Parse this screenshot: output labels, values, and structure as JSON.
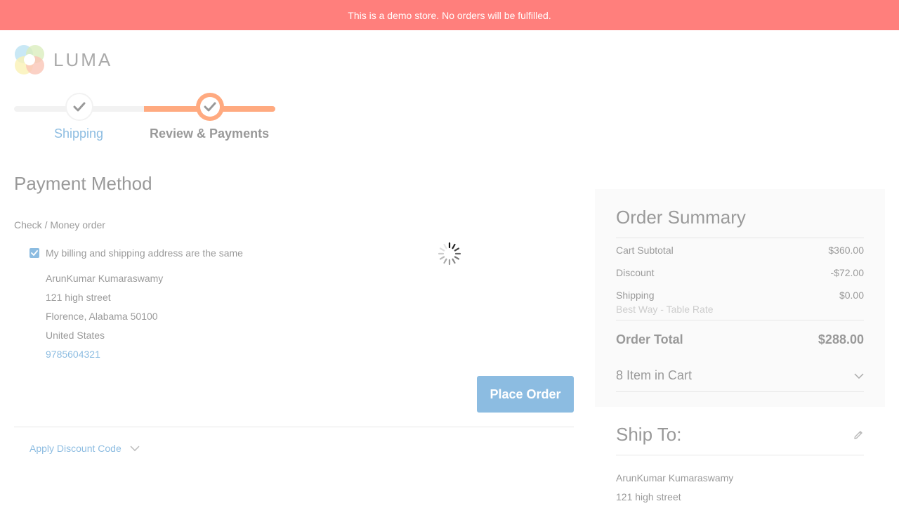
{
  "banner": {
    "text": "This is a demo store. No orders will be fulfilled."
  },
  "logo": {
    "text": "LUMA"
  },
  "progress": {
    "steps": [
      {
        "label": "Shipping"
      },
      {
        "label": "Review & Payments"
      }
    ]
  },
  "payment": {
    "title": "Payment Method",
    "method_title": "Check / Money order",
    "same_address_label": "My billing and shipping address are the same",
    "address": {
      "name": "ArunKumar Kumaraswamy",
      "street": "121 high street",
      "city_line": "Florence, Alabama 50100",
      "country": "United States",
      "phone": "9785604321"
    },
    "place_order_label": "Place Order",
    "discount_label": "Apply Discount Code"
  },
  "summary": {
    "title": "Order Summary",
    "rows": [
      {
        "label": "Cart Subtotal",
        "value": "$360.00"
      },
      {
        "label": "Discount",
        "value": "-$72.00"
      },
      {
        "label": "Shipping",
        "value": "$0.00"
      }
    ],
    "shipping_method": "Best Way - Table Rate",
    "total_label": "Order Total",
    "total_value": "$288.00",
    "items_label": "8 Item in Cart"
  },
  "ship_to": {
    "title": "Ship To:",
    "name": "ArunKumar Kumaraswamy",
    "street": "121 high street"
  },
  "colors": {
    "banner": "#ff7f7c",
    "accent_blue": "#1979c3",
    "accent_orange": "#ff5501"
  }
}
